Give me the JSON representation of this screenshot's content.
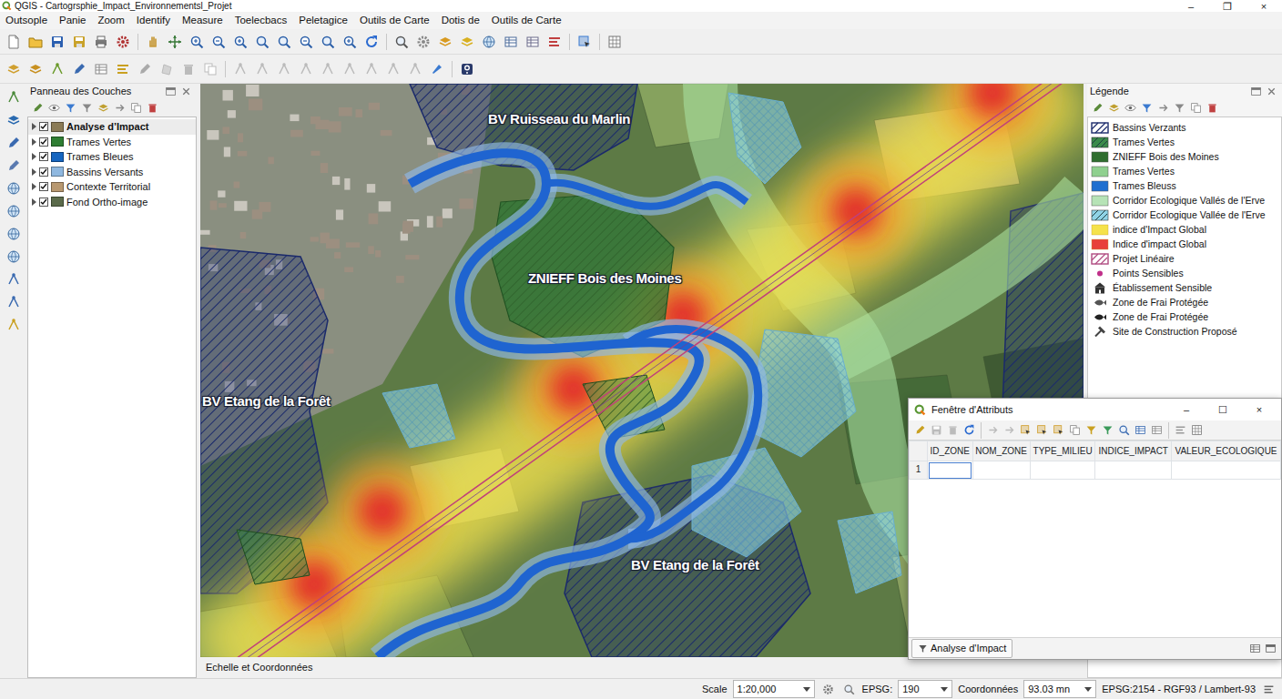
{
  "window": {
    "title": "QGIS - Cartogrsphie_Impact_Environnementsl_Projet",
    "controls": [
      "–",
      "❐",
      "×"
    ]
  },
  "menu": [
    "Outsople",
    "Panie",
    "Zoom",
    "Identify",
    "Measure",
    "Toelecbacs",
    "Peletagice",
    "Outils de Carte",
    "Dotis de",
    "Outils de Carte"
  ],
  "layers_panel": {
    "title": "Panneau des Couches",
    "layers": [
      {
        "label": "Analyse d’Impact",
        "checked": true,
        "selected": true,
        "color": "#8a7a55"
      },
      {
        "label": "Trames Vertes",
        "checked": true,
        "selected": false,
        "color": "#2e7d32"
      },
      {
        "label": "Trames Bleues",
        "checked": true,
        "selected": false,
        "color": "#1565c0"
      },
      {
        "label": "Bassins Versants",
        "checked": true,
        "selected": false,
        "color": "#8fb8e0"
      },
      {
        "label": "Contexte Territorial",
        "checked": true,
        "selected": false,
        "color": "#b89870"
      },
      {
        "label": "Fond Ortho-image",
        "checked": true,
        "selected": false,
        "color": "#5a6a4a"
      }
    ]
  },
  "map": {
    "labels": [
      "BV Ruisseau du Marlin",
      "ZNIEFF Bois des Moines",
      "BV Etang de la Forêt",
      "BV Etang de la Forêt"
    ]
  },
  "map_footer": "Echelle et Coordonnées",
  "legend": {
    "title": "Légende",
    "items": [
      {
        "label": "Bassins Verzants",
        "kind": "hatch",
        "color": "#1b2a6b"
      },
      {
        "label": "Trames Vertes",
        "kind": "hatch-fill",
        "color": "#3a8a4a"
      },
      {
        "label": "ZNIEFF Bois des Moines",
        "kind": "fill",
        "color": "#2f6e2f"
      },
      {
        "label": "Trames Vertes",
        "kind": "fill",
        "color": "#8fd08f"
      },
      {
        "label": "Trames Bleuss",
        "kind": "fill",
        "color": "#1f6fd0"
      },
      {
        "label": "Corridor Ecologique Vallés de l'Erve",
        "kind": "fill",
        "color": "#b6e3b6"
      },
      {
        "label": "Corridor Ecologique Vallée de l'Erve",
        "kind": "hatch-fill",
        "color": "#8fd3e6"
      },
      {
        "label": "indice d'Impact Global",
        "kind": "gradient",
        "color": "#f5e24a"
      },
      {
        "label": "Indice d'impact Global",
        "kind": "gradient",
        "color": "#e8403a"
      },
      {
        "label": "Projet Linéaire",
        "kind": "hatch",
        "color": "#b04a80"
      },
      {
        "label": "Points Sensibles",
        "kind": "point",
        "color": "#c0308a"
      },
      {
        "label": "Établissement Sensible",
        "kind": "symbol",
        "color": "#333333"
      },
      {
        "label": "Zone de Frai Protégée",
        "kind": "symbol",
        "color": "#555555"
      },
      {
        "label": "Zone de Frai Protégée",
        "kind": "symbol",
        "color": "#222222"
      },
      {
        "label": "Site de Construction Proposé",
        "kind": "symbol",
        "color": "#444444"
      }
    ]
  },
  "attribute_window": {
    "title": "Fenêtre d'Attributs",
    "controls": [
      "–",
      "☐",
      "×"
    ],
    "columns": [
      "ID_ZONE",
      "NOM_ZONE",
      "TYPE_MILIEU",
      "INDICE_IMPACT",
      "VALEUR_ECOLOGIQUE"
    ],
    "rows": [
      {
        "number": "1",
        "cells": [
          "",
          "",
          "",
          "",
          ""
        ]
      }
    ],
    "filter_button": "Analyse d'Impact"
  },
  "status_bar": {
    "scale_label": "Scale",
    "scale": "1:20,000",
    "epsg_label": "EPSG:",
    "epsg": "190",
    "coords_label": "Coordonnées",
    "coords": "93.03 mn",
    "crs": "EPSG:2154 - RGF93 / Lambert-93"
  }
}
